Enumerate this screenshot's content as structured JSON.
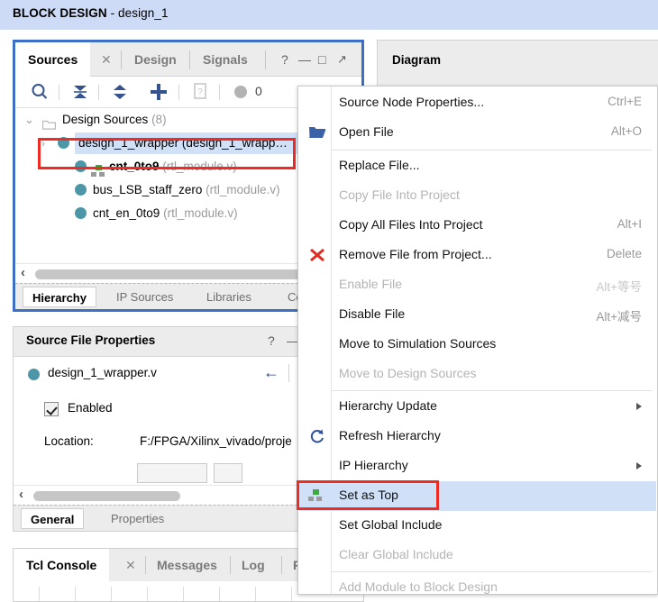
{
  "banner": {
    "title_bold": "BLOCK DESIGN",
    "title_rest": " - design_1"
  },
  "sources_panel": {
    "tabs": [
      {
        "label": "Sources",
        "active": true
      },
      {
        "label": "Design",
        "active": false
      },
      {
        "label": "Signals",
        "active": false
      }
    ],
    "close_glyph": "✕",
    "window_buttons": [
      "?",
      "—",
      "□",
      "↗"
    ],
    "toolbar": {
      "search_icon": "search-icon",
      "collapse_all_icon": "collapse-all-icon",
      "expand_collapse_icon": "expand-collapse-icon",
      "add_sources_icon": "add-sources-icon",
      "report_icon": "report-icon",
      "status_count": "0"
    },
    "tree": [
      {
        "label": "Design Sources",
        "suffix": " (8)",
        "file": "",
        "depth": 0,
        "expander": "⌄",
        "folder": true,
        "dot": false,
        "bold": false,
        "hier_icon": false,
        "selected": false
      },
      {
        "label": "design_1_wrapper",
        "suffix": "",
        "file": " (design_1_wrapp…",
        "depth": 1,
        "expander": "›",
        "folder": false,
        "dot": true,
        "bold": false,
        "hier_icon": false,
        "selected": true
      },
      {
        "label": "cnt_0to9",
        "suffix": "",
        "file": " (rtl_module.v)",
        "depth": 2,
        "expander": "",
        "folder": false,
        "dot": true,
        "bold": true,
        "hier_icon": true,
        "selected": false
      },
      {
        "label": "bus_LSB_staff_zero",
        "suffix": "",
        "file": " (rtl_module.v)",
        "depth": 2,
        "expander": "",
        "folder": false,
        "dot": true,
        "bold": false,
        "hier_icon": false,
        "selected": false
      },
      {
        "label": "cnt_en_0to9",
        "suffix": "",
        "file": " (rtl_module.v)",
        "depth": 2,
        "expander": "",
        "folder": false,
        "dot": true,
        "bold": false,
        "hier_icon": false,
        "selected": false
      }
    ],
    "hscroll_arrow": "‹",
    "bottom_tabs": [
      {
        "label": "Hierarchy",
        "active": true
      },
      {
        "label": "IP Sources",
        "active": false
      },
      {
        "label": "Libraries",
        "active": false
      },
      {
        "label": "Co",
        "active": false
      }
    ]
  },
  "source_file_properties": {
    "title": "Source File Properties",
    "help_glyph": "?",
    "minimize_glyph": "—",
    "file_name": "design_1_wrapper.v",
    "back_arrow": "←",
    "enabled_label": "Enabled",
    "location_label": "Location:",
    "location_value": "F:/FPGA/Xilinx_vivado/proje",
    "hscroll_arrow": "‹",
    "bottom_tabs": [
      {
        "label": "General",
        "active": true
      },
      {
        "label": "Properties",
        "active": false
      }
    ]
  },
  "tcl_console": {
    "tabs": [
      {
        "label": "Tcl Console",
        "active": true
      },
      {
        "label": "Messages",
        "active": false
      },
      {
        "label": "Log",
        "active": false
      },
      {
        "label": "Re",
        "active": false
      }
    ],
    "close_glyph": "✕"
  },
  "diagram_panel": {
    "title": "Diagram"
  },
  "context_menu": {
    "items": [
      {
        "label": "Source Node Properties...",
        "accel": "Ctrl+E",
        "disabled": false,
        "icon": "",
        "submenu": false,
        "highlight": false,
        "sep_after": false
      },
      {
        "label": "Open File",
        "accel": "Alt+O",
        "disabled": false,
        "icon": "open-folder-icon",
        "submenu": false,
        "highlight": false,
        "sep_after": true
      },
      {
        "label": "Replace File...",
        "accel": "",
        "disabled": false,
        "icon": "",
        "submenu": false,
        "highlight": false,
        "sep_after": false
      },
      {
        "label": "Copy File Into Project",
        "accel": "",
        "disabled": true,
        "icon": "",
        "submenu": false,
        "highlight": false,
        "sep_after": false
      },
      {
        "label": "Copy All Files Into Project",
        "accel": "Alt+I",
        "disabled": false,
        "icon": "",
        "submenu": false,
        "highlight": false,
        "sep_after": false
      },
      {
        "label": "Remove File from Project...",
        "accel": "Delete",
        "disabled": false,
        "icon": "remove-x-icon",
        "submenu": false,
        "highlight": false,
        "sep_after": false
      },
      {
        "label": "Enable File",
        "accel": "Alt+等号",
        "disabled": true,
        "icon": "",
        "submenu": false,
        "highlight": false,
        "sep_after": false
      },
      {
        "label": "Disable File",
        "accel": "Alt+减号",
        "disabled": false,
        "icon": "",
        "submenu": false,
        "highlight": false,
        "sep_after": false
      },
      {
        "label": "Move to Simulation Sources",
        "accel": "",
        "disabled": false,
        "icon": "",
        "submenu": false,
        "highlight": false,
        "sep_after": false
      },
      {
        "label": "Move to Design Sources",
        "accel": "",
        "disabled": true,
        "icon": "",
        "submenu": false,
        "highlight": false,
        "sep_after": true
      },
      {
        "label": "Hierarchy Update",
        "accel": "",
        "disabled": false,
        "icon": "",
        "submenu": true,
        "highlight": false,
        "sep_after": false
      },
      {
        "label": "Refresh Hierarchy",
        "accel": "",
        "disabled": false,
        "icon": "refresh-icon",
        "submenu": false,
        "highlight": false,
        "sep_after": false
      },
      {
        "label": "IP Hierarchy",
        "accel": "",
        "disabled": false,
        "icon": "",
        "submenu": true,
        "highlight": false,
        "sep_after": false
      },
      {
        "label": "Set as Top",
        "accel": "",
        "disabled": false,
        "icon": "set-as-top-icon",
        "submenu": false,
        "highlight": true,
        "sep_after": false
      },
      {
        "label": "Set Global Include",
        "accel": "",
        "disabled": false,
        "icon": "",
        "submenu": false,
        "highlight": false,
        "sep_after": false
      },
      {
        "label": "Clear Global Include",
        "accel": "",
        "disabled": true,
        "icon": "",
        "submenu": false,
        "highlight": false,
        "sep_after": true
      },
      {
        "label": "Add Module to Block Design",
        "accel": "",
        "disabled": true,
        "icon": "",
        "submenu": false,
        "highlight": false,
        "sep_after": false
      }
    ]
  },
  "annotations": {
    "highlight_boxes": [
      {
        "name": "selected-source-highlight"
      },
      {
        "name": "set-as-top-highlight"
      }
    ]
  },
  "colors": {
    "banner_bg": "#cddbf7",
    "focus_border": "#3d6fc4",
    "annotation_red": "#ee2b24",
    "selection_blue": "#cfe0f7",
    "node_dot_teal": "#4b97a8",
    "top_green": "#3aab3a"
  }
}
